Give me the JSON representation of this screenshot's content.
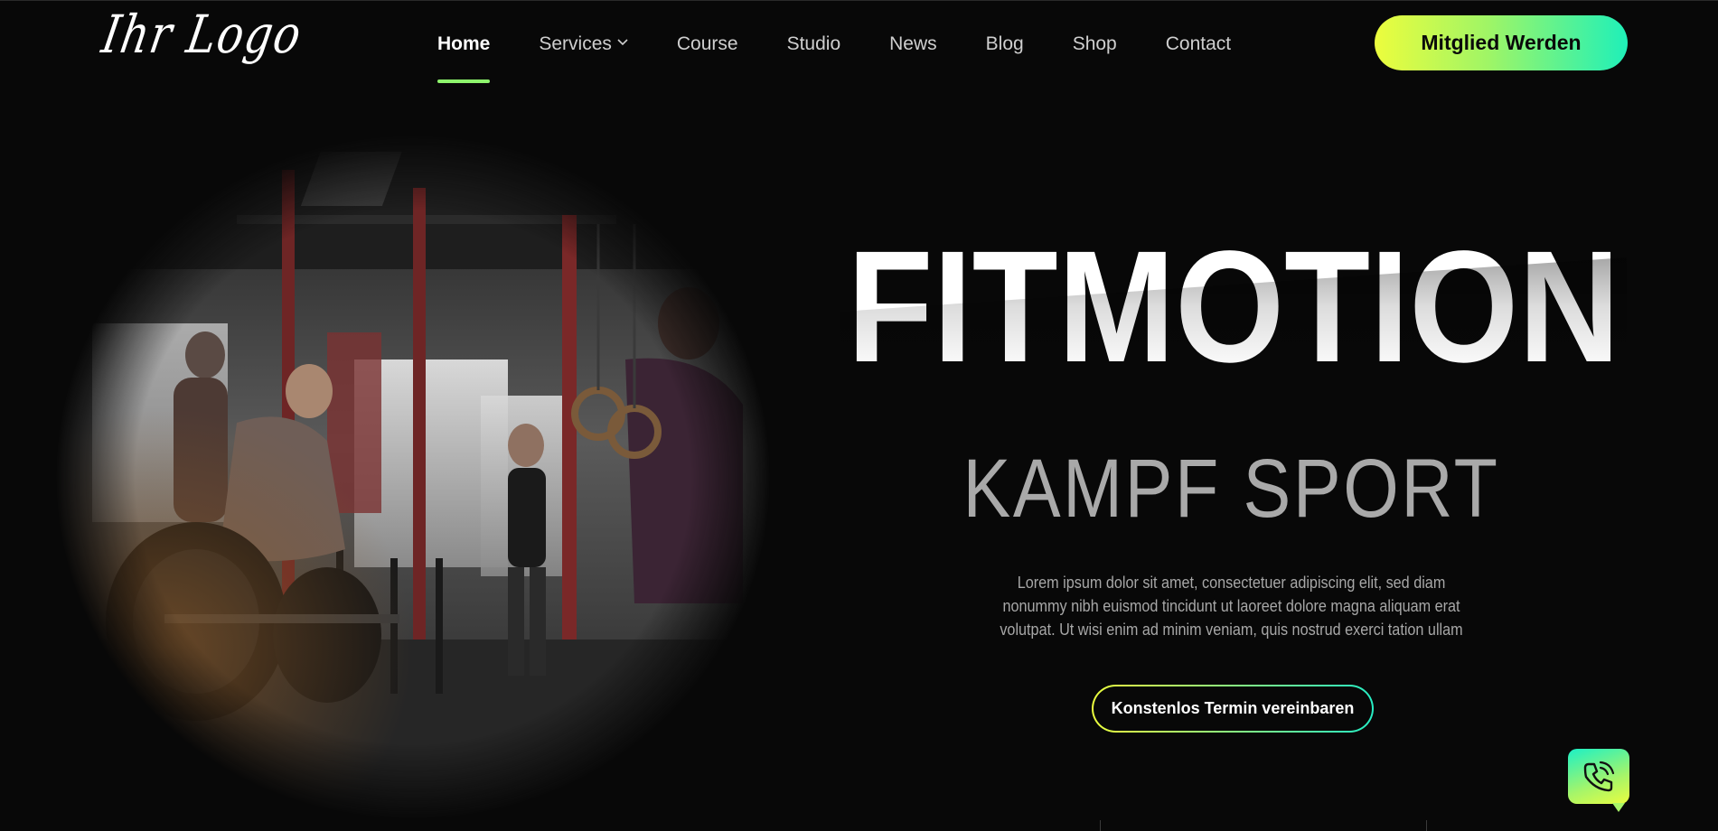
{
  "header": {
    "logo_text": "Ihr Logo",
    "nav": [
      {
        "label": "Home",
        "active": true
      },
      {
        "label": "Services",
        "has_dropdown": true
      },
      {
        "label": "Course"
      },
      {
        "label": "Studio"
      },
      {
        "label": "News"
      },
      {
        "label": "Blog"
      },
      {
        "label": "Shop"
      },
      {
        "label": "Contact"
      }
    ],
    "cta_label": "Mitglied Werden"
  },
  "hero": {
    "title": "FITMOTION",
    "subtitle": "KAMPF SPORT",
    "lead": "Lorem ipsum dolor sit amet, consectetuer adipiscing elit, sed diam nonummy nibh euismod tincidunt ut laoreet dolore magna aliquam erat volutpat. Ut wisi enim ad minim veniam, quis nostrud exerci tation ullam",
    "button_label": "Konstenlos Termin vereinbaren",
    "image_icon": "gym-photo"
  },
  "widgets": {
    "call_icon": "phone-call-icon"
  },
  "colors": {
    "accent_yellow": "#ecfd3d",
    "accent_green": "#8ef56d",
    "accent_teal": "#1ff0b9",
    "background": "#080808"
  }
}
